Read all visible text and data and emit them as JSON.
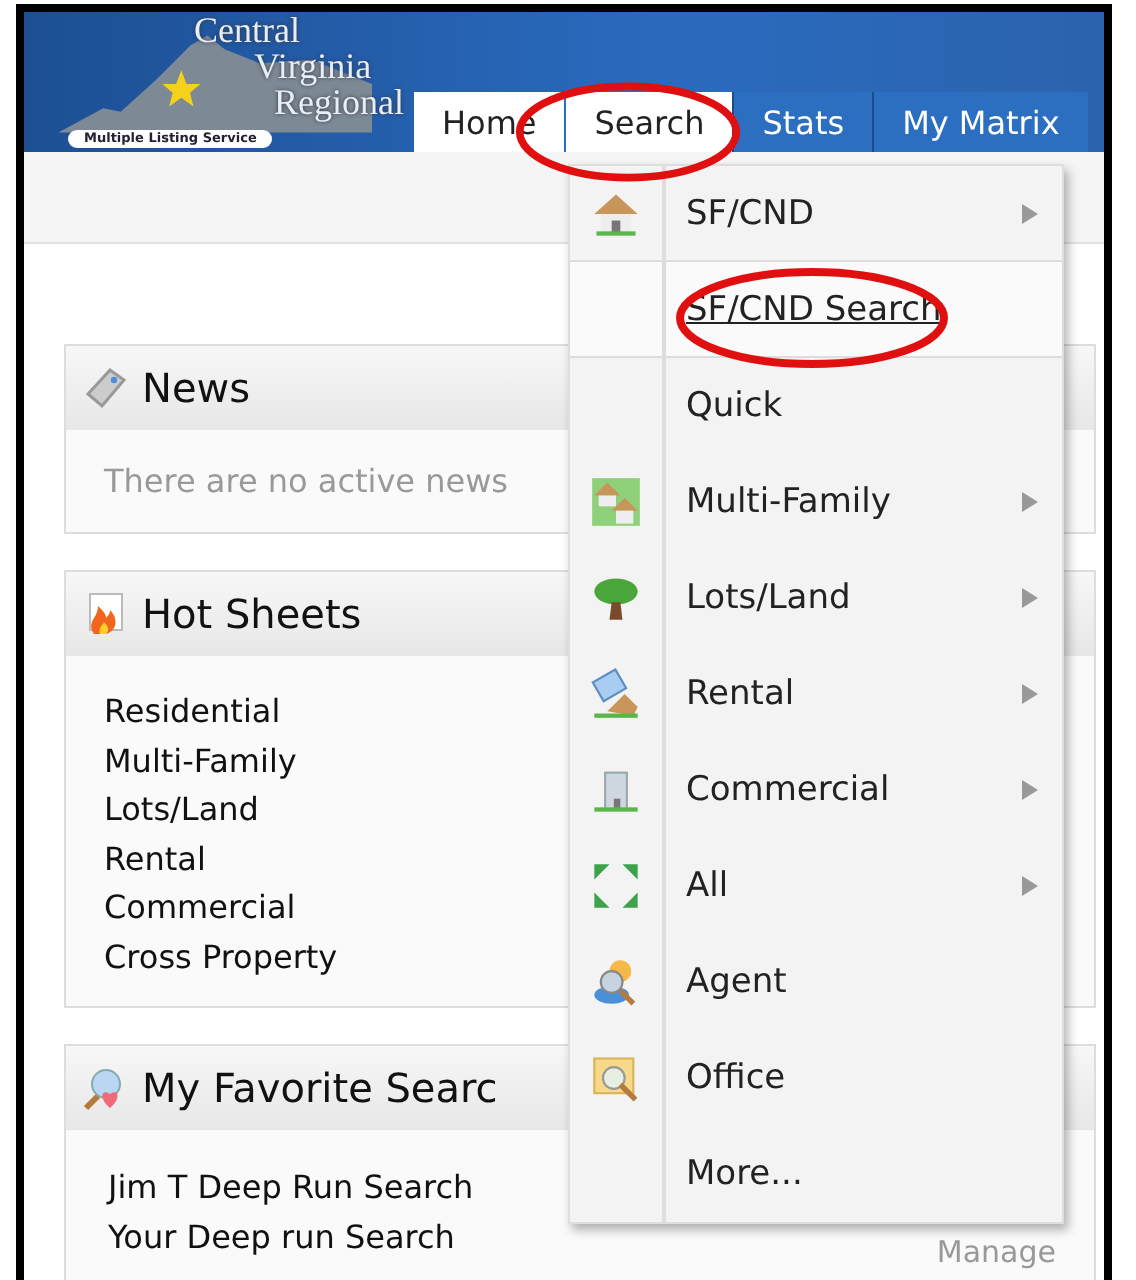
{
  "logo": {
    "lines": [
      "Central",
      "Virginia",
      "Regional"
    ],
    "tagline": "Multiple Listing Service"
  },
  "tabs": [
    {
      "label": "Home",
      "selected": true,
      "open": false
    },
    {
      "label": "Search",
      "selected": false,
      "open": true
    },
    {
      "label": "Stats",
      "selected": false,
      "open": false
    },
    {
      "label": "My Matrix",
      "selected": false,
      "open": false
    }
  ],
  "panels": [
    {
      "kind": "message",
      "title": "News",
      "message": "There are no active news"
    },
    {
      "kind": "links",
      "title": "Hot Sheets",
      "items": [
        "Residential",
        "Multi-Family",
        "Lots/Land",
        "Rental",
        "Commercial",
        "Cross Property"
      ]
    },
    {
      "kind": "links",
      "title": "My Favorite Searc",
      "items": [
        "Jim T Deep Run Search",
        "Your Deep run Search"
      ],
      "action": "Manage"
    }
  ],
  "menu": [
    {
      "label": "SF/CND",
      "submenu": true,
      "hovered": false
    },
    {
      "label": "SF/CND Search",
      "submenu": false,
      "hovered": true
    },
    {
      "label": "Quick",
      "submenu": false,
      "hovered": false
    },
    {
      "label": "Multi-Family",
      "submenu": true,
      "hovered": false
    },
    {
      "label": "Lots/Land",
      "submenu": true,
      "hovered": false
    },
    {
      "label": "Rental",
      "submenu": true,
      "hovered": false
    },
    {
      "label": "Commercial",
      "submenu": true,
      "hovered": false
    },
    {
      "label": "All",
      "submenu": true,
      "hovered": false
    },
    {
      "label": "Agent",
      "submenu": false,
      "hovered": false
    },
    {
      "label": "Office",
      "submenu": false,
      "hovered": false
    },
    {
      "label": "More...",
      "submenu": false,
      "hovered": false
    }
  ]
}
